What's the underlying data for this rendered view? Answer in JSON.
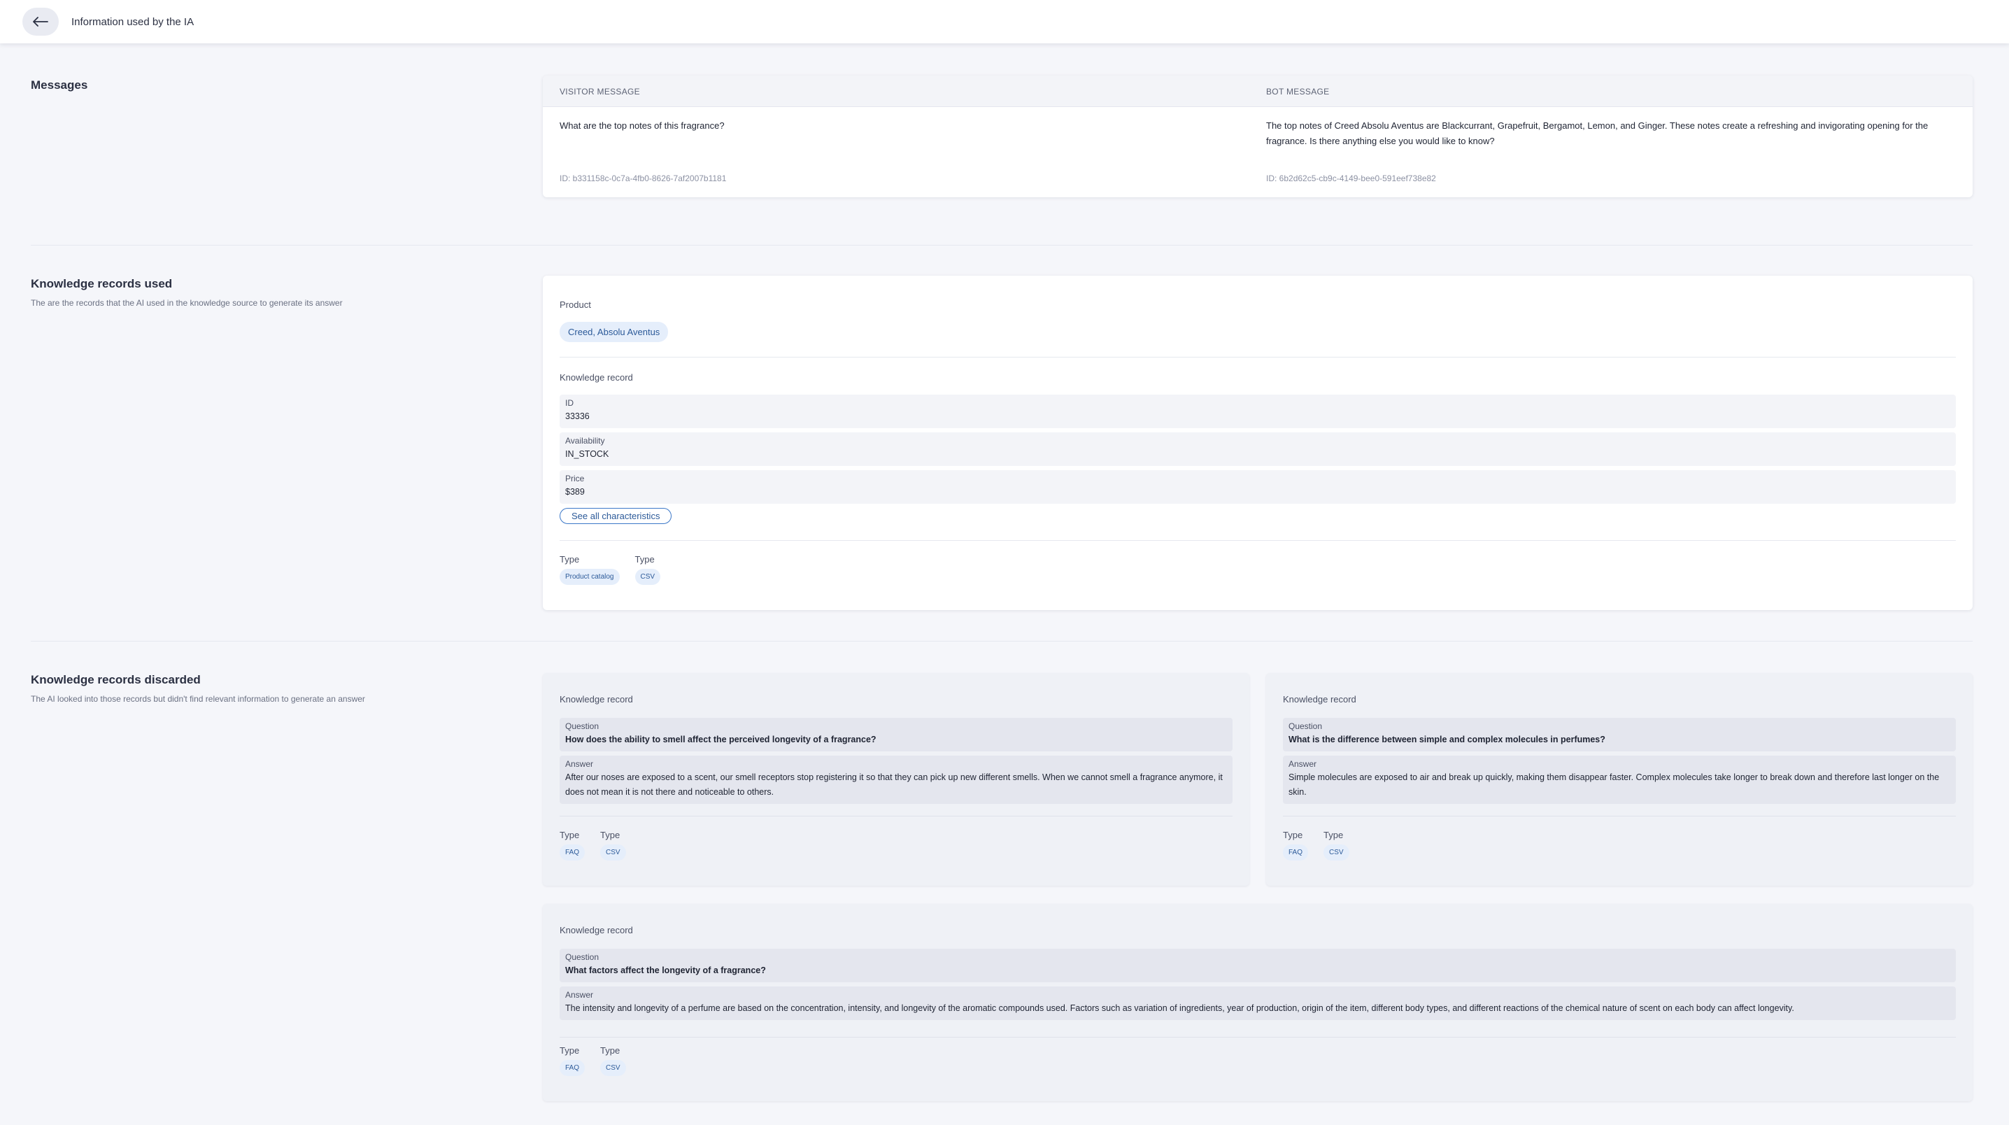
{
  "header": {
    "title": "Information used by the IA"
  },
  "messages": {
    "section_title": "Messages",
    "visitor": {
      "header": "VISITOR MESSAGE",
      "text": "What are the top notes of this fragrance?",
      "id": "ID: b331158c-0c7a-4fb0-8626-7af2007b1181"
    },
    "bot": {
      "header": "BOT MESSAGE",
      "text": "The top notes of Creed Absolu Aventus are Blackcurrant, Grapefruit, Bergamot, Lemon, and Ginger. These notes create a refreshing and invigorating opening for the fragrance. Is there anything else you would like to know?",
      "id": "ID: 6b2d62c5-cb9c-4149-bee0-591eef738e82"
    }
  },
  "used": {
    "section_title": "Knowledge records used",
    "section_subtitle": "The are the records that the AI used in the knowledge source to generate its answer",
    "product_label": "Product",
    "product_chip": "Creed, Absolu Aventus",
    "record_label": "Knowledge record",
    "fields": [
      {
        "name": "ID",
        "value": "33336"
      },
      {
        "name": "Availability",
        "value": "IN_STOCK"
      },
      {
        "name": "Price",
        "value": "$389"
      }
    ],
    "see_all": "See all characteristics",
    "types": [
      {
        "label": "Type",
        "value": "Product catalog"
      },
      {
        "label": "Type",
        "value": "CSV"
      }
    ]
  },
  "discarded": {
    "section_title": "Knowledge records discarded",
    "section_subtitle": "The AI looked into those records but didn't find relevant information to generate an answer",
    "records": [
      {
        "label": "Knowledge record",
        "question_label": "Question",
        "question": "How does the ability to smell affect the perceived longevity of a fragrance?",
        "answer_label": "Answer",
        "answer": "After our noses are exposed to a scent, our smell receptors stop registering it so that they can pick up new different smells. When we cannot smell a fragrance anymore, it does not mean it is not there and noticeable to others.",
        "types": [
          {
            "label": "Type",
            "value": "FAQ"
          },
          {
            "label": "Type",
            "value": "CSV"
          }
        ]
      },
      {
        "label": "Knowledge record",
        "question_label": "Question",
        "question": "What is the difference between simple and complex molecules in perfumes?",
        "answer_label": "Answer",
        "answer": "Simple molecules are exposed to air and break up quickly, making them disappear faster. Complex molecules take longer to break down and therefore last longer on the skin.",
        "types": [
          {
            "label": "Type",
            "value": "FAQ"
          },
          {
            "label": "Type",
            "value": "CSV"
          }
        ]
      },
      {
        "label": "Knowledge record",
        "question_label": "Question",
        "question": "What factors affect the longevity of a fragrance?",
        "answer_label": "Answer",
        "answer": "The intensity and longevity of a perfume are based on the concentration, intensity, and longevity of the aromatic compounds used. Factors such as variation of ingredients, year of production, origin of the item, different body types, and different reactions of the chemical nature of scent on each body can affect longevity.",
        "types": [
          {
            "label": "Type",
            "value": "FAQ"
          },
          {
            "label": "Type",
            "value": "CSV"
          }
        ]
      }
    ]
  }
}
